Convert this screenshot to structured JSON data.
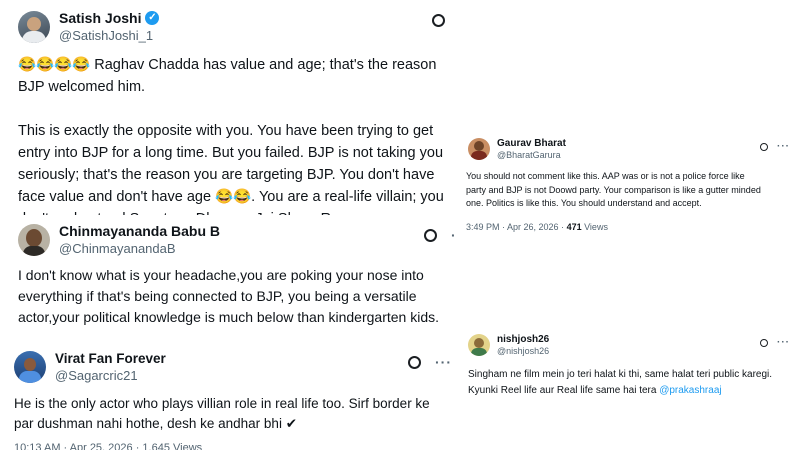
{
  "tweets": [
    {
      "name": "Satish Joshi",
      "handle": "@SatishJoshi_1",
      "emoji_lead": "😂😂😂😂",
      "p1": " Raghav Chadda has value and age; that's the reason BJP welcomed him.",
      "p2a": "This is exactly the opposite with you. You have been trying to get entry into BJP for a long time. But you failed. BJP is not taking you seriously; that's the reason you are targeting BJP. You don't have face value and don't have age ",
      "p2_emoji": "😂😂",
      "p2b": ". You are a real-life villain; you don't understand Sanatana Dharma. Jai Shree Ram."
    },
    {
      "name": "Chinmayananda Babu B",
      "handle": "@ChinmayanandaB",
      "text": "I don't know what is your headache,you are poking your nose into everything if that's being connected to BJP, you being a versatile actor,your political knowledge is much below than kindergarten kids."
    },
    {
      "name": "Virat Fan Forever",
      "handle": "@Sagarcric21",
      "text": "He is the only actor who plays villian role in real life too. Sirf border ke par dushman nahi hothe, desh ke andhar bhi ✔",
      "meta_partial": "10:13 AM · Apr 25, 2026 · 1,645 Views"
    },
    {
      "name": "Gaurav Bharat",
      "handle": "@BharatGarura",
      "text": "You should not comment like this. AAP was or is not a police force like party and BJP is not Doowd party. Your comparison is like a gutter minded one. Politics is like this. You should understand and accept.",
      "time": "3:49 PM · Apr 26, 2026 · ",
      "views_count": "471",
      "views_label": " Views"
    },
    {
      "name": "nishjosh26",
      "handle": "@nishjosh26",
      "text": "Singham ne film mein jo teri halat ki thi, same halat teri public karegi. Kyunki Reel life aur Real life same hai tera ",
      "mention": "@prakashraaj"
    }
  ],
  "icons": {
    "grok": "grok-icon",
    "more": "more-icon",
    "verified": "verified-badge-icon"
  },
  "colors": {
    "verified": "#1d9bf0",
    "link": "#1d9bf0",
    "muted": "#536471"
  }
}
